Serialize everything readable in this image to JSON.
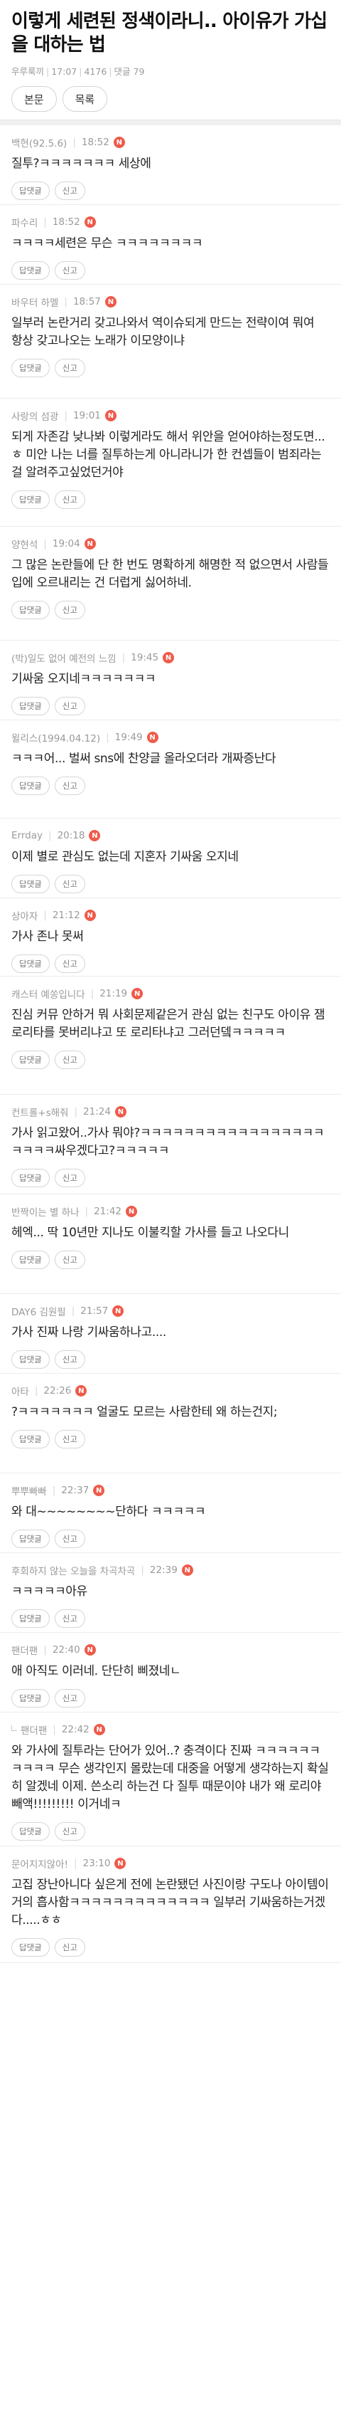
{
  "article": {
    "title": "이렇게 세련된 정색이라니.. 아이유가 가십을 대하는 법",
    "author": "우루룩끼",
    "time": "17:07",
    "views": "4176",
    "comments_label": "댓글 79"
  },
  "buttons": {
    "body": "본문",
    "list": "목록"
  },
  "labels": {
    "reply": "답댓글",
    "report": "신고",
    "new": "N"
  },
  "comments": [
    {
      "author": "백현(92.5.6)",
      "time": "18:52",
      "text": "질투?ㅋㅋㅋㅋㅋㅋㅋ 세상에",
      "h": 112
    },
    {
      "author": "파수리",
      "time": "18:52",
      "text": "ㅋㅋㅋㅋ세련은 무슨 ㅋㅋㅋㅋㅋㅋㅋㅋ",
      "h": 112
    },
    {
      "author": "바우터 하멜",
      "time": "18:57",
      "text": "일부러 논란거리 갖고나와서 역이슈되게 만드는 전략이여 뭐여\n항상 갖고나오는 노래가 이모양이냐",
      "h": 160
    },
    {
      "author": "사랑의 섬광",
      "time": "19:01",
      "text": "되게 자존감 낮나봐 이렇게라도 해서 위안을 얻어야하는정도면...ㅎ 미안 나는 너를 질투하는게 아니라니가 한 컨셉들이 범죄라는걸 알려주고싶었던거야",
      "h": 180
    },
    {
      "author": "양현석",
      "time": "19:04",
      "text": "그 많은 논란들에 단 한 번도 명확하게 해명한 적 없으면서 사람들 입에 오르내리는 건 더럽게 싫어하네.",
      "h": 160
    },
    {
      "author": "(박)일도 없어 예전의 느낌",
      "time": "19:45",
      "text": "기싸움 오지네ㅋㅋㅋㅋㅋㅋㅋ",
      "h": 112
    },
    {
      "author": "윌리스(1994.04.12)",
      "time": "19:49",
      "text": "ㅋㅋㅋ어... 벌써 sns에 찬양글 올라오더라 개짜증난다",
      "h": 138
    },
    {
      "author": "Errday",
      "time": "20:18",
      "text": "이제 별로 관심도 없는데 지혼자 기싸움 오지네",
      "h": 112
    },
    {
      "author": "상아자",
      "time": "21:12",
      "text": "가사 존나 못써",
      "h": 110
    },
    {
      "author": "캐스터 예쏭입니다",
      "time": "21:19",
      "text": "진심 커뮤 안하거 뭐 사회문제같은거 관심 없는 친구도 아이유 잼 로리타를 못버리냐고 또 로리타냐고 그러던뎈ㅋㅋㅋㅋㅋ",
      "h": 166
    },
    {
      "author": "컨트롤+s해줘",
      "time": "21:24",
      "text": "가사 읽고왔어..가사 뭐야?ㅋㅋㅋㅋㅋㅋㅋㅋㅋㅋㅋㅋㅋㅋㅋㅋㅋㅋㅋㅋㅋ싸우겠다고?ㅋㅋㅋㅋㅋ",
      "h": 140
    },
    {
      "author": "반짝이는 별 하나",
      "time": "21:42",
      "text": "헤엑... 딱 10년만 지나도 이불킥할 가사를 들고 나오다니",
      "h": 140
    },
    {
      "author": "DAY6 김원필",
      "time": "21:57",
      "text": "가사 진짜 나랑 기싸움하나고....",
      "h": 112
    },
    {
      "author": "아타",
      "time": "22:26",
      "text": "?ㅋㅋㅋㅋㅋㅋㅋ 얼굴도 모르는 사람한테 왜 하는건지;",
      "h": 140
    },
    {
      "author": "뿌뿌빠빠",
      "time": "22:37",
      "text": "와 대~~~~~~~~단하다 ㅋㅋㅋㅋㅋ",
      "h": 112
    },
    {
      "author": "후회하지 않는 오늘을 차곡차곡",
      "time": "22:39",
      "text": "ㅋㅋㅋㅋㅋ아유",
      "h": 112
    },
    {
      "author": "팬더팬",
      "time": "22:40",
      "text": "애 아직도 이러네. 단단히 삐졌네ㄴ",
      "h": 112
    },
    {
      "author": "팬더팬",
      "time": "22:42",
      "text": "와 가사에 질투라는 단어가 있어..? 충격이다 진짜 ㅋㅋㅋㅋㅋㅋㅋㅋㅋㅋ 무슨 생각인지 몰랐는데 대중을 어떻게 생각하는지 확실히 알겠네 이제. 쓴소리 하는건 다 질투 때문이야 내가 왜 로리야 빼액!!!!!!!!! 이거네ㅋ",
      "h": 188,
      "reply": true
    },
    {
      "author": "문어지지않아!",
      "time": "23:10",
      "text": "고집 장난아니다 싶은게 전에 논란됐던 사진이랑 구도나 아이템이 거의 흡사함ㅋㅋㅋㅋㅋㅋㅋㅋㅋㅋㅋㅋㅋ 일부러 기싸움하는거겠다.....ㅎㅎ",
      "h": 164
    }
  ]
}
